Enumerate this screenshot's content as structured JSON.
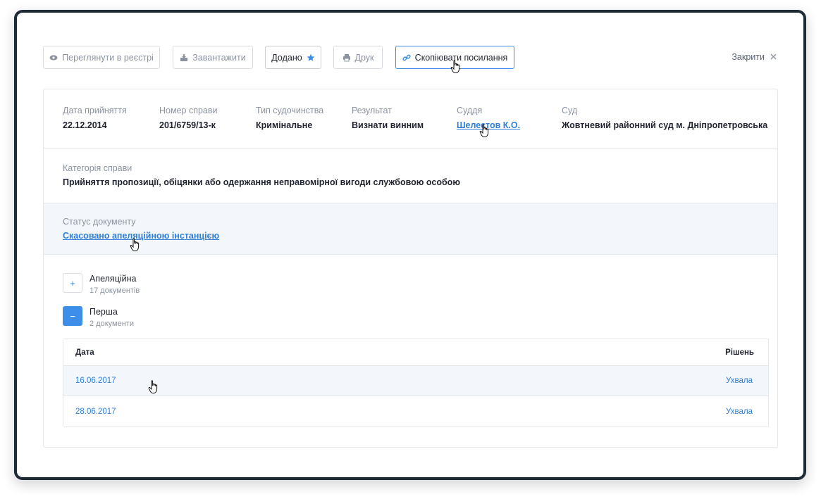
{
  "toolbar": {
    "view_registry": "Переглянути в реєстрі",
    "download": "Завантажити",
    "added": "Додано",
    "print": "Друк",
    "copy_link": "Скопіювати посилання",
    "close": "Закрити"
  },
  "meta": [
    {
      "label": "Дата прийняття",
      "value": "22.12.2014"
    },
    {
      "label": "Номер справи",
      "value": "201/6759/13-к"
    },
    {
      "label": "Тип судочинства",
      "value": "Кримінальне"
    },
    {
      "label": "Результат",
      "value": "Визнати винним"
    },
    {
      "label": "Суддя",
      "value": "Шелестов К.О."
    },
    {
      "label": "Суд",
      "value": "Жовтневий районний суд м. Дніпропетровська"
    }
  ],
  "category": {
    "label": "Категорія справи",
    "value": "Прийняття пропозиції, обіцянки або одержання неправомірної вигоди службовою особою"
  },
  "status": {
    "label": "Статус документу",
    "value": "Скасовано апеляційною інстанцією"
  },
  "instances": [
    {
      "name": "Апеляційна",
      "count": "17 документів",
      "toggle": "+",
      "expanded": false
    },
    {
      "name": "Перша",
      "count": "2 документи",
      "toggle": "−",
      "expanded": true
    }
  ],
  "table": {
    "headers": {
      "date": "Дата",
      "decision": "Рішень"
    },
    "rows": [
      {
        "date": "16.06.2017",
        "decision": "Ухвала"
      },
      {
        "date": "28.06.2017",
        "decision": "Ухвала"
      }
    ]
  },
  "colors": {
    "accent": "#3d8ee8",
    "link": "#2f7fd8",
    "frame": "#1f2a37"
  }
}
